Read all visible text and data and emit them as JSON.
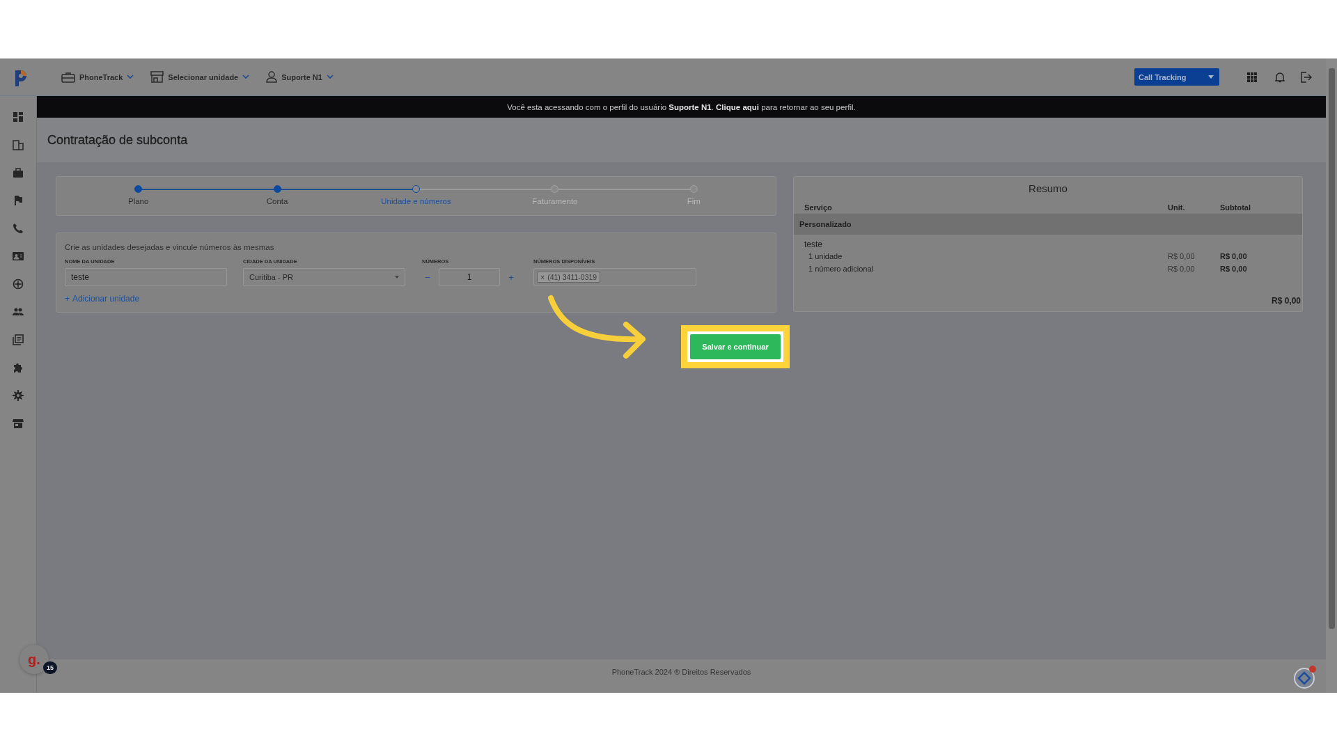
{
  "topbar": {
    "menus": [
      {
        "label": "PhoneTrack"
      },
      {
        "label": "Selecionar unidade"
      },
      {
        "label": "Suporte N1"
      }
    ],
    "product_select": {
      "value": "Call Tracking"
    }
  },
  "banner": {
    "before": "Você esta acessando com o perfil do usuário **Suporte N1**. ",
    "link": "Clique aqui",
    "after": " para retornar ao seu perfil."
  },
  "page": {
    "title": "Contratação de subconta"
  },
  "stepper": {
    "steps": [
      {
        "label": "Plano",
        "completed": true,
        "selected": false
      },
      {
        "label": "Conta",
        "completed": true,
        "selected": false
      },
      {
        "label": "Unidade e números",
        "completed": false,
        "selected": true
      },
      {
        "label": "Faturamento",
        "completed": false,
        "selected": false
      },
      {
        "label": "Fim",
        "completed": false,
        "selected": false
      }
    ]
  },
  "unit_form": {
    "intro": "Crie as unidades desejadas e vincule números às mesmas",
    "name": {
      "label": "NOME DA UNIDADE",
      "value": "teste"
    },
    "city": {
      "label": "CIDADE DA UNIDADE",
      "value": "Curitiba - PR"
    },
    "numbers": {
      "label": "NÚMEROS",
      "value": "1",
      "decrement": "−",
      "increment": "+"
    },
    "available": {
      "label": "NÚMEROS DISPONÍVEIS",
      "tags": [
        {
          "remove": "×",
          "text": "(41) 3411-0319"
        }
      ]
    },
    "add_link": {
      "icon": "+",
      "label": "Adicionar unidade"
    }
  },
  "summary": {
    "title": "Resumo",
    "columns": [
      "Serviço",
      "Unit.",
      "Subtotal"
    ],
    "group": "Personalizado",
    "unit": "teste",
    "lines": [
      {
        "label": "1 unidade",
        "unit": "R$ 0,00",
        "subtotal": "R$ 0,00"
      },
      {
        "label": "1 número adicional",
        "unit": "R$ 0,00",
        "subtotal": "R$ 0,00"
      }
    ],
    "total": "R$ 0,00"
  },
  "callout": {
    "button": "Salvar e continuar"
  },
  "footer": {
    "text": "PhoneTrack 2024 ® Direitos Reservados"
  },
  "avatar": {
    "letter": "g.",
    "badge": "15"
  }
}
